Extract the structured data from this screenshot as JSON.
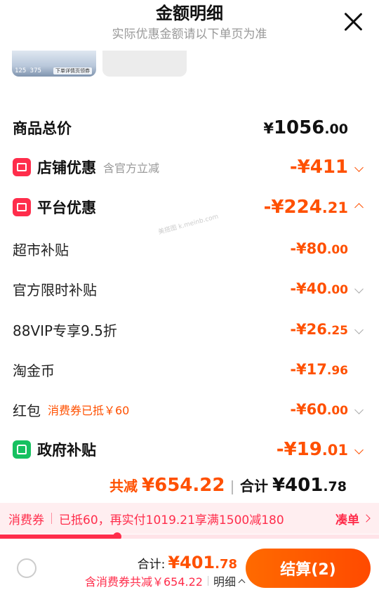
{
  "header": {
    "title": "金额明细",
    "subtitle": "实际优惠金额请以下单页为准"
  },
  "thumbs": {
    "left_text": "125 375",
    "right_text": "下单详情页领券"
  },
  "watermark": "美搭图 k.meinb.com",
  "total_row": {
    "label": "商品总价",
    "currency": "¥",
    "int": "1056",
    "dec": ".00"
  },
  "shop_discount": {
    "label": "店铺优惠",
    "note": "含官方立减",
    "amount": "-¥411",
    "icon": "shop-icon"
  },
  "platform_discount": {
    "label": "平台优惠",
    "amount_int": "-¥224",
    "amount_dec": ".21",
    "icon": "ticket-icon"
  },
  "items": [
    {
      "label": "超市补贴",
      "int": "-¥80",
      "dec": ".00",
      "chevron": false
    },
    {
      "label": "官方限时补贴",
      "int": "-¥40",
      "dec": ".00",
      "chevron": true
    },
    {
      "label": "88VIP专享9.5折",
      "int": "-¥26",
      "dec": ".25",
      "chevron": true
    },
    {
      "label": "淘金币",
      "int": "-¥17",
      "dec": ".96",
      "chevron": false
    },
    {
      "label": "红包",
      "note": "消费券已抵￥60",
      "int": "-¥60",
      "dec": ".00",
      "chevron": true
    }
  ],
  "gov_subsidy": {
    "label": "政府补贴",
    "amount_int": "-¥19",
    "amount_dec": ".01",
    "icon": "house-icon"
  },
  "summary": {
    "saved_label": "共减",
    "saved_value": "¥654.22",
    "total_label": "合计",
    "total_int": "¥401",
    "total_dec": ".78"
  },
  "banner": {
    "tag": "消费券",
    "text": "已抵60，再实付1019.21享满1500减180",
    "action": "凑单"
  },
  "progress": {
    "fraction": 0.31
  },
  "footer": {
    "total_label": "合计:",
    "total_int": "¥401",
    "total_dec": ".78",
    "sub_text": "含消费券共减￥654.22",
    "detail": "明细",
    "pay_label": "结算(2)"
  },
  "colors": {
    "accent": "#ff5000",
    "red": "#ff2d4b",
    "green": "#16c160"
  }
}
